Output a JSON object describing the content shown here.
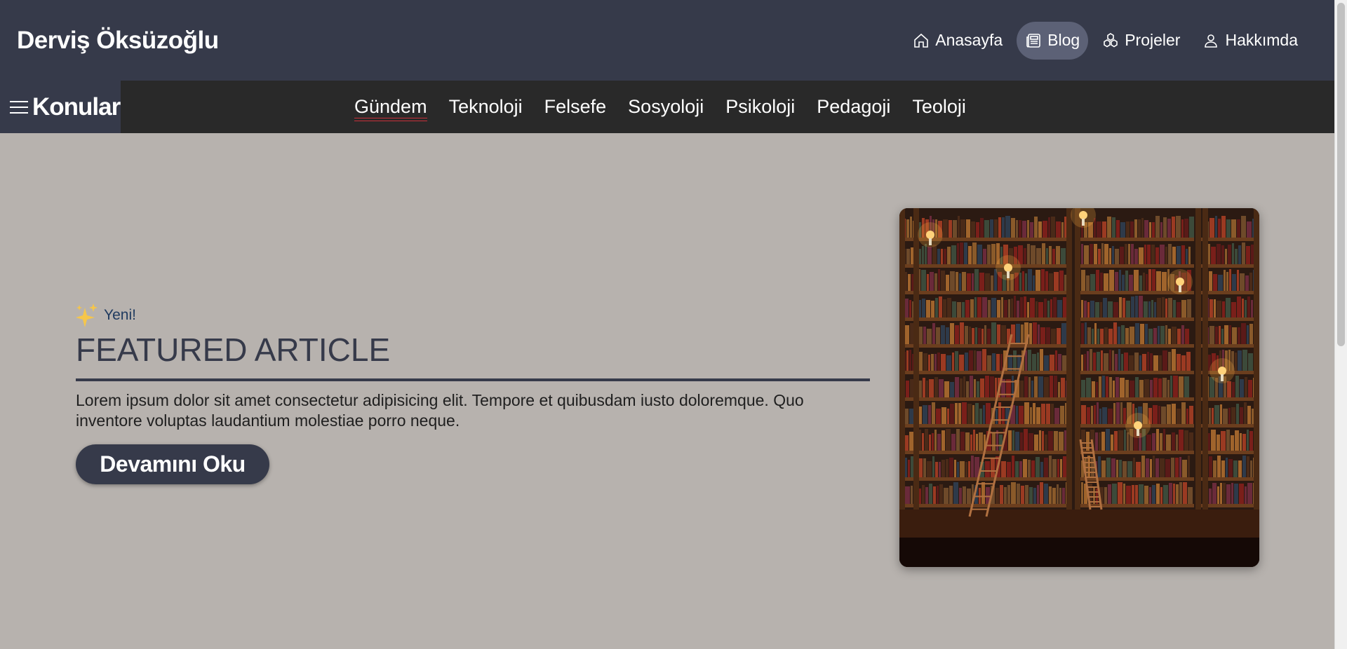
{
  "header": {
    "brand": "Derviş Öksüzoğlu",
    "nav": [
      {
        "label": "Anasayfa",
        "icon": "home-icon",
        "active": false
      },
      {
        "label": "Blog",
        "icon": "newspaper-icon",
        "active": true
      },
      {
        "label": "Projeler",
        "icon": "cubes-icon",
        "active": false
      },
      {
        "label": "Hakkımda",
        "icon": "user-icon",
        "active": false
      }
    ]
  },
  "topics": {
    "menu_label": "Konular",
    "items": [
      "Gündem",
      "Teknoloji",
      "Felsefe",
      "Sosyoloji",
      "Psikoloji",
      "Pedagoji",
      "Teoloji"
    ],
    "active": "Gündem"
  },
  "featured": {
    "badge": "Yeni!",
    "title": "FEATURED ARTICLE",
    "description": "Lorem ipsum dolor sit amet consectetur adipisicing elit. Tempore et quibusdam iusto doloremque. Quo inventore voluptas laudantium molestiae porro neque.",
    "button": "Devamını Oku",
    "image": "library-bookshelves-image"
  },
  "colors": {
    "header_bg": "#363a4a",
    "topic_bar_bg": "#292929",
    "page_bg": "#b7b2ae",
    "active_pill": "#5c6176",
    "active_underline": "#c9303a"
  }
}
